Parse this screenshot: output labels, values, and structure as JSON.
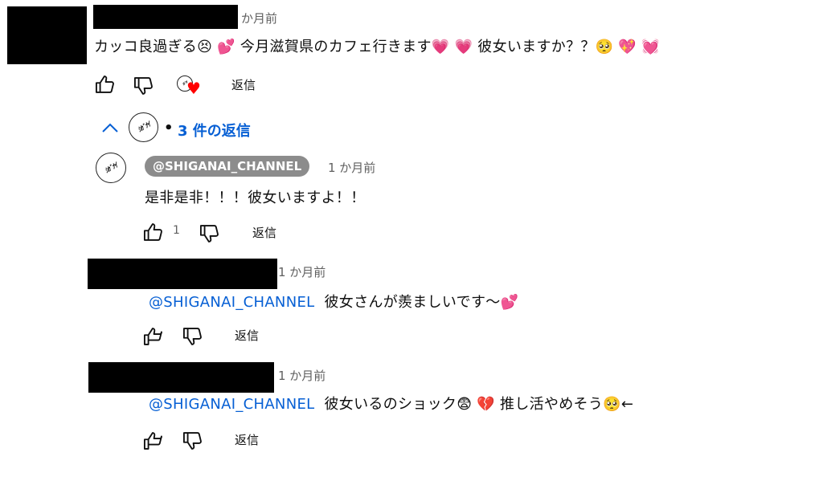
{
  "top_comment": {
    "time": "か月前",
    "text": "カッコ良過ぎる😣 💕 今月滋賀県のカフェ行きます💗 💗 彼女いますか？？🥺 💖 💓",
    "reply_label": "返信",
    "creator_heart": "♥",
    "logo_glyph": "ｼｶﾞﾅｲ"
  },
  "replies_toggle": {
    "text": "3 件の返信",
    "separator": "•"
  },
  "replies": [
    {
      "author": "@SHIGANAI_CHANNEL",
      "time": "1 か月前",
      "text": "是非是非！！！彼女いますよ！！",
      "like_count": "1",
      "reply_label": "返信"
    },
    {
      "time": "1 か月前",
      "mention": "@SHIGANAI_CHANNEL",
      "text": "彼女さんが羨ましいです～💕",
      "reply_label": "返信"
    },
    {
      "time": "1 か月前",
      "mention": "@SHIGANAI_CHANNEL",
      "text": "彼女いるのショック😨 💔 推し活やめそう🥺←",
      "reply_label": "返信"
    }
  ],
  "colors": {
    "link": "#065fd4",
    "meta": "#606060",
    "heart": "#ff0000",
    "chip_bg": "#8c8c8c"
  },
  "icons": [
    "thumbs-up-icon",
    "thumbs-down-icon",
    "heart-icon",
    "chevron-up-icon",
    "channel-logo"
  ]
}
